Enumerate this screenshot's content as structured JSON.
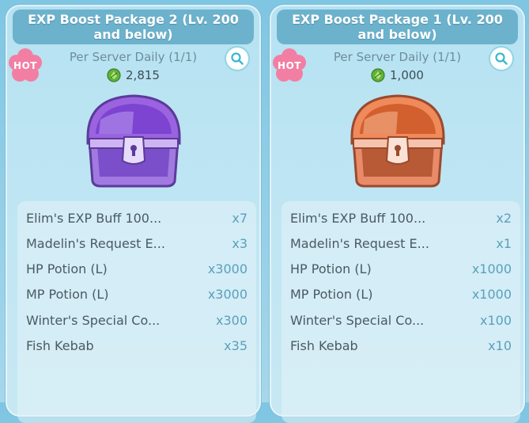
{
  "packages": [
    {
      "title": "EXP Boost Package 2 (Lv. 200 and below)",
      "badge": "HOT",
      "limit": "Per Server Daily (1/1)",
      "price": "2,815",
      "currency_icon": "gem-icon",
      "chest_color": "purple",
      "items": [
        {
          "name": "Elim's EXP Buff 100...",
          "qty": "x7"
        },
        {
          "name": "Madelin's Request E...",
          "qty": "x3"
        },
        {
          "name": "HP Potion (L)",
          "qty": "x3000"
        },
        {
          "name": "MP Potion (L)",
          "qty": "x3000"
        },
        {
          "name": "Winter's Special Co...",
          "qty": "x300"
        },
        {
          "name": "Fish Kebab",
          "qty": "x35"
        }
      ]
    },
    {
      "title": "EXP Boost Package 1 (Lv. 200 and below)",
      "badge": "HOT",
      "limit": "Per Server Daily (1/1)",
      "price": "1,000",
      "currency_icon": "gem-icon",
      "chest_color": "orange",
      "items": [
        {
          "name": "Elim's EXP Buff 100...",
          "qty": "x2"
        },
        {
          "name": "Madelin's Request E...",
          "qty": "x1"
        },
        {
          "name": "HP Potion (L)",
          "qty": "x1000"
        },
        {
          "name": "MP Potion (L)",
          "qty": "x1000"
        },
        {
          "name": "Winter's Special Co...",
          "qty": "x100"
        },
        {
          "name": "Fish Kebab",
          "qty": "x10"
        }
      ]
    }
  ]
}
